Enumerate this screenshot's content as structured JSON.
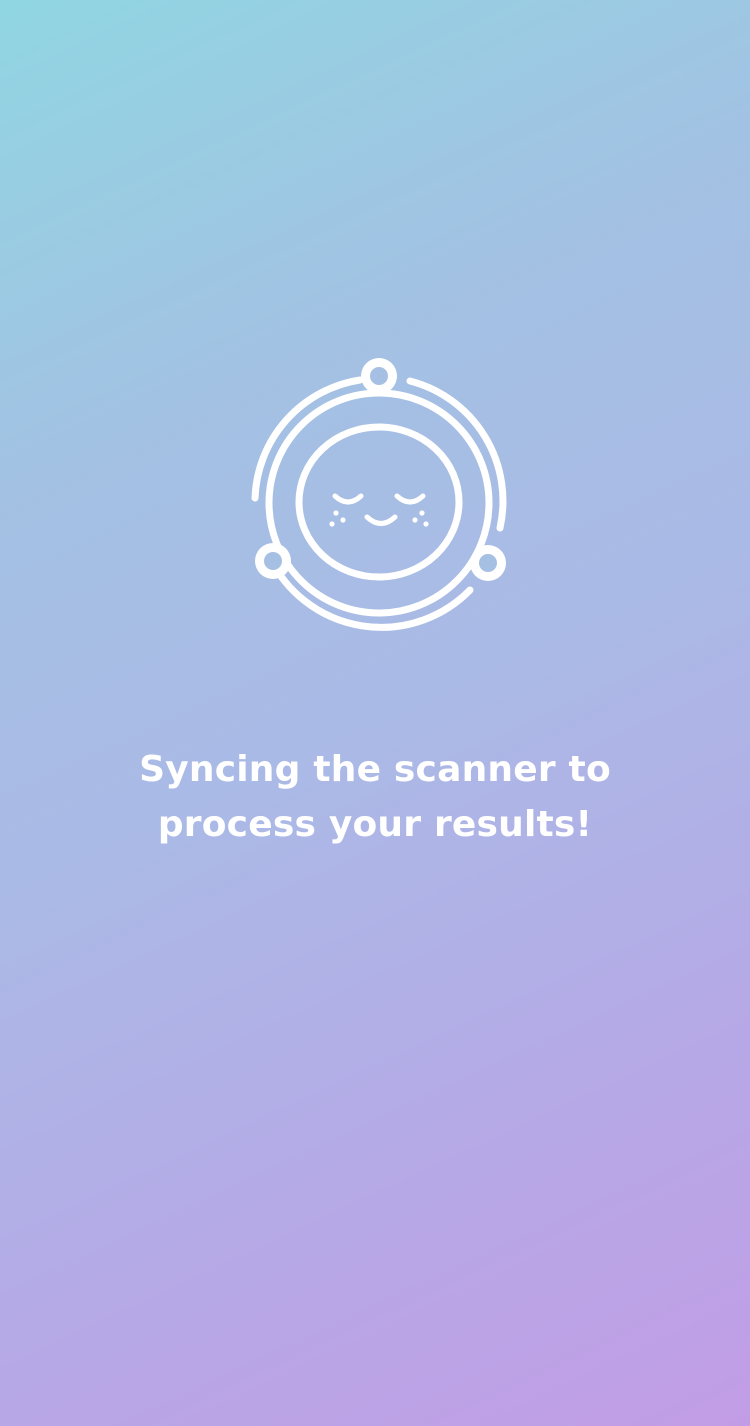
{
  "screen": {
    "message": "Syncing the scanner to\nprocess your results!",
    "logo_icon": "sleeping-face-scanner-icon"
  },
  "colors": {
    "gradient_start": "#90d6e2",
    "gradient_end": "#c29de6",
    "foreground": "#ffffff"
  }
}
